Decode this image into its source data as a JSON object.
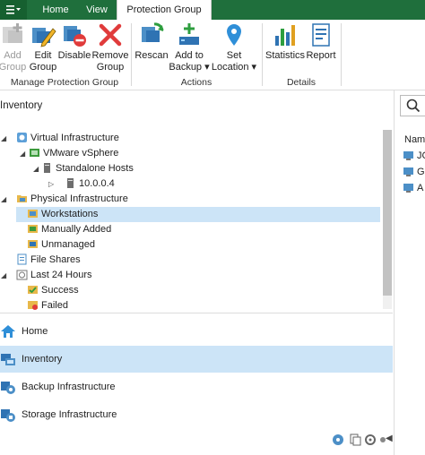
{
  "tabs": [
    {
      "label": "Home"
    },
    {
      "label": "View"
    },
    {
      "label": "Protection Group",
      "active": true
    }
  ],
  "ribbon": {
    "groups": [
      {
        "label": "Manage Protection Group"
      },
      {
        "label": "Actions"
      },
      {
        "label": "Details"
      }
    ],
    "buttons": {
      "add_group": {
        "line1": "Add",
        "line2": "Group",
        "disabled": true
      },
      "edit_group": {
        "line1": "Edit",
        "line2": "Group"
      },
      "disable": {
        "line1": "Disable",
        "line2": ""
      },
      "remove_group": {
        "line1": "Remove",
        "line2": "Group"
      },
      "rescan": {
        "line1": "Rescan",
        "line2": ""
      },
      "add_to_backup": {
        "line1": "Add to",
        "line2": "Backup ▾"
      },
      "set_location": {
        "line1": "Set",
        "line2": "Location ▾"
      },
      "statistics": {
        "line1": "Statistics",
        "line2": ""
      },
      "report": {
        "line1": "Report",
        "line2": ""
      }
    }
  },
  "left_panel": {
    "title": "Inventory",
    "tree": [
      {
        "label": "Virtual Infrastructure",
        "icon": "virtual-infrastructure-icon"
      },
      {
        "label": "VMware vSphere",
        "icon": "vmware-icon"
      },
      {
        "label": "Standalone Hosts",
        "icon": "hosts-icon"
      },
      {
        "label": "10.0.0.4",
        "icon": "server-icon"
      },
      {
        "label": "Physical Infrastructure",
        "icon": "folder-icon"
      },
      {
        "label": "Workstations",
        "icon": "workstations-icon",
        "selected": true
      },
      {
        "label": "Manually Added",
        "icon": "manual-group-icon"
      },
      {
        "label": "Unmanaged",
        "icon": "unmanaged-icon"
      },
      {
        "label": "File Shares",
        "icon": "file-shares-icon"
      },
      {
        "label": "Last 24 Hours",
        "icon": "history-icon"
      },
      {
        "label": "Success",
        "icon": "success-icon"
      },
      {
        "label": "Failed",
        "icon": "failed-icon"
      }
    ],
    "nav": [
      {
        "label": "Home",
        "icon": "home-icon"
      },
      {
        "label": "Inventory",
        "icon": "inventory-icon",
        "selected": true
      },
      {
        "label": "Backup Infrastructure",
        "icon": "backup-infrastructure-icon"
      },
      {
        "label": "Storage Infrastructure",
        "icon": "storage-infrastructure-icon"
      }
    ]
  },
  "right_panel": {
    "column_header": "Name",
    "rows": [
      {
        "label": "JC"
      },
      {
        "label": "Gi"
      },
      {
        "label": "A"
      }
    ]
  },
  "colors": {
    "accent": "#1f6f3c",
    "selection": "#cce4f7"
  }
}
